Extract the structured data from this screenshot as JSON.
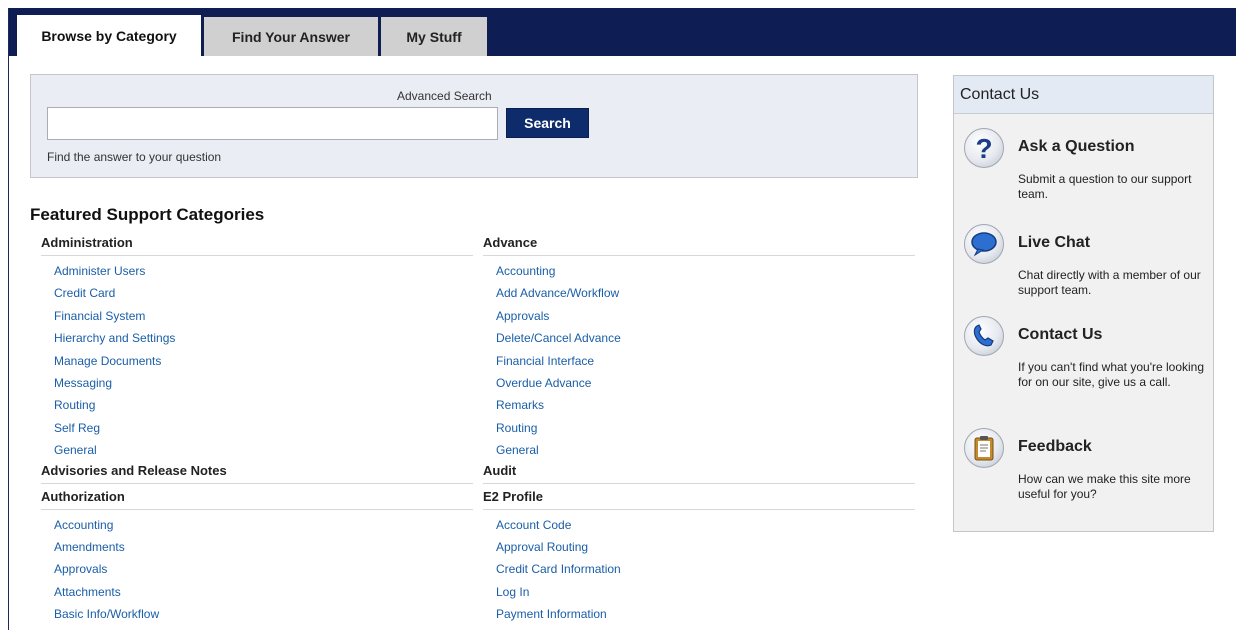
{
  "tabs": [
    {
      "label": "Browse by Category",
      "active": true
    },
    {
      "label": "Find Your Answer",
      "active": false
    },
    {
      "label": "My Stuff",
      "active": false
    }
  ],
  "search": {
    "advanced_label": "Advanced Search",
    "input_value": "",
    "button_label": "Search",
    "hint": "Find the answer to your question"
  },
  "featured": {
    "title": "Featured Support Categories",
    "left": [
      {
        "heading": "Administration",
        "links": [
          "Administer Users",
          "Credit Card",
          "Financial System",
          "Hierarchy and Settings",
          "Manage Documents",
          "Messaging",
          "Routing",
          "Self Reg",
          "General"
        ]
      },
      {
        "heading": "Advisories and Release Notes",
        "links": []
      },
      {
        "heading": "Authorization",
        "links": [
          "Accounting",
          "Amendments",
          "Approvals",
          "Attachments",
          "Basic Info/Workflow"
        ]
      }
    ],
    "right": [
      {
        "heading": "Advance",
        "links": [
          "Accounting",
          "Add Advance/Workflow",
          "Approvals",
          "Delete/Cancel Advance",
          "Financial Interface",
          "Overdue Advance",
          "Remarks",
          "Routing",
          "General"
        ]
      },
      {
        "heading": "Audit",
        "links": []
      },
      {
        "heading": "E2 Profile",
        "links": [
          "Account Code",
          "Approval Routing",
          "Credit Card Information",
          "Log In",
          "Payment Information"
        ]
      }
    ]
  },
  "contact": {
    "title": "Contact Us",
    "items": [
      {
        "icon": "question-icon",
        "title": "Ask a Question",
        "desc": "Submit a question to our support team."
      },
      {
        "icon": "chat-bubble-icon",
        "title": "Live Chat",
        "desc": "Chat directly with a member of our support team."
      },
      {
        "icon": "phone-icon",
        "title": "Contact Us",
        "desc": "If you can't find what you're looking for on our site, give us a call."
      },
      {
        "icon": "clipboard-icon",
        "title": "Feedback",
        "desc": "How can we make this site more useful for you?"
      }
    ]
  },
  "colors": {
    "tabbar": "#0e1d54",
    "link": "#1a5ea8",
    "button": "#0e2c6b"
  }
}
